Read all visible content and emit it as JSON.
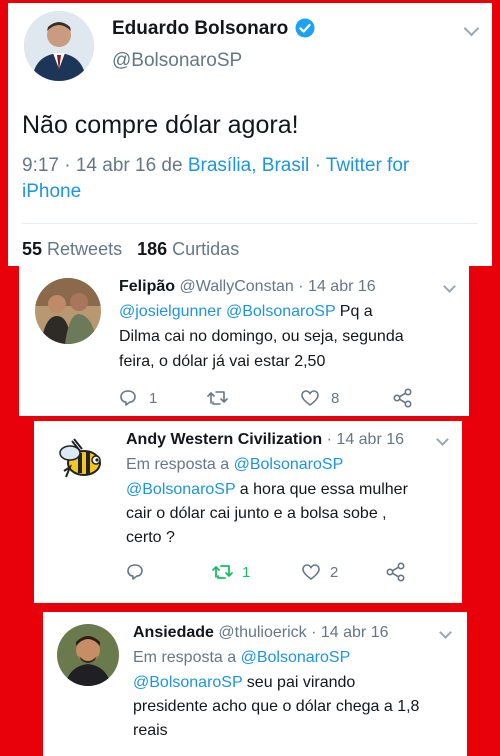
{
  "main_tweet": {
    "name": "Eduardo Bolsonaro",
    "handle": "@BolsonaroSP",
    "text": "Não compre dólar agora!",
    "time": "9:17 · 14 abr 16 de",
    "location": "Brasília, Brasil",
    "source_line1": "· Twitter for",
    "source_line2": "iPhone",
    "retweets_count": "55",
    "retweets_label": "Retweets",
    "likes_count": "186",
    "likes_label": "Curtidas"
  },
  "replies": [
    {
      "name": "Felipão",
      "handle": "@WallyConstan",
      "date": "· 14 abr 16",
      "mention1": "@josielgunner",
      "mention2": "@BolsonaroSP",
      "line1_tail": "Pq a",
      "line2": "Dilma cai no domingo, ou seja, segunda",
      "line3": "feira, o dólar já vai estar 2,50",
      "reply_count": "1",
      "retweet_count": "",
      "like_count": "8"
    },
    {
      "name": "Andy Western Civilization",
      "date": "· 14 abr 16",
      "reply_prefix": "Em resposta a",
      "reply_to": "@BolsonaroSP",
      "mention": "@BolsonaroSP",
      "line1_tail": "a hora que essa mulher",
      "line2": "cair o dólar cai junto e a bolsa sobe ,",
      "line3": "certo ?",
      "retweet_count": "1",
      "like_count": "2"
    },
    {
      "name": "Ansiedade",
      "handle": "@thulioerick",
      "date": "· 14 abr 16",
      "reply_prefix": "Em resposta a",
      "reply_to": "@BolsonaroSP",
      "mention": "@BolsonaroSP",
      "line1_tail": "seu pai virando",
      "line2": "presidente acho que o dólar chega a 1,8",
      "line3": "reais"
    }
  ]
}
